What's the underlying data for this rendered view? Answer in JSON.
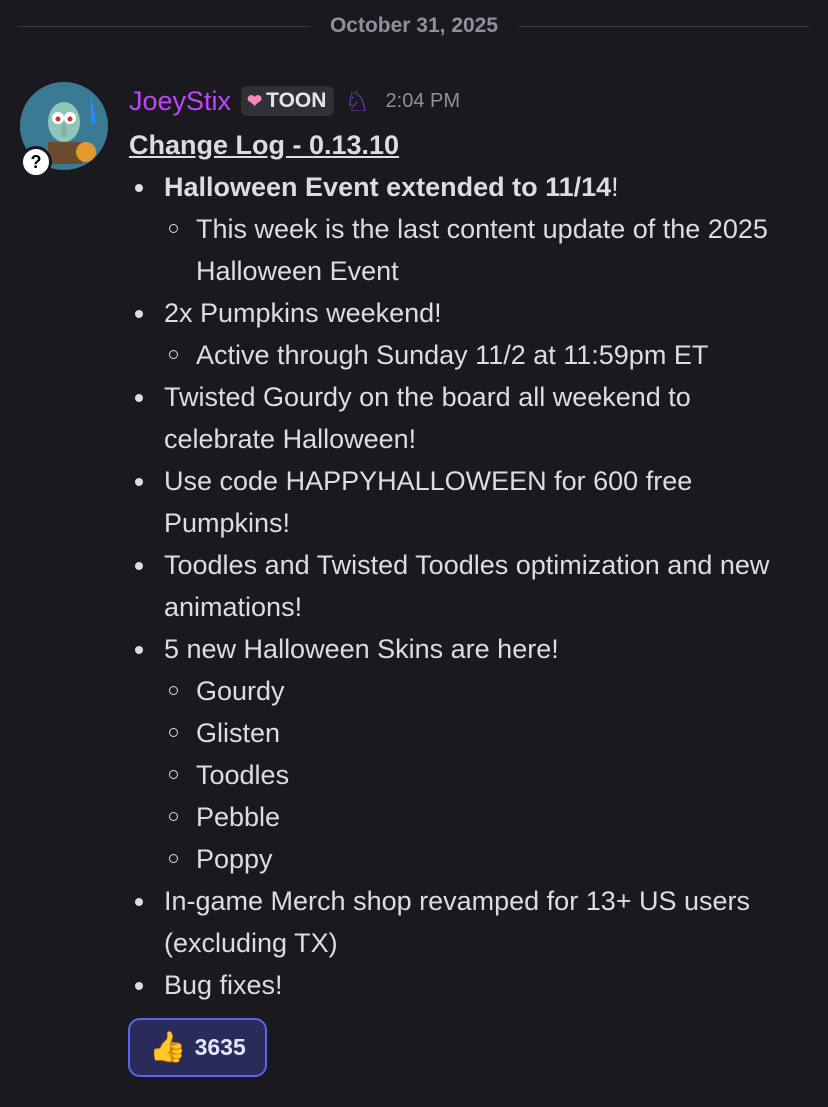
{
  "date_divider": "October 31, 2025",
  "message": {
    "author": "JoeyStix",
    "author_color": "#c145ff",
    "tag_icon": "heart-icon",
    "tag_label": "TOON",
    "role_icon": "purple-monster-icon",
    "timestamp": "2:04 PM",
    "title": "Change Log - 0.13.10",
    "items": [
      {
        "text_bold": "Halloween Event extended to 11/14",
        "text_after": "!",
        "sub": [
          "This week is the last content update of the 2025 Halloween Event"
        ]
      },
      {
        "text": "2x Pumpkins weekend!",
        "sub": [
          "Active through Sunday 11/2 at 11:59pm ET"
        ]
      },
      {
        "text": "Twisted Gourdy on the board all weekend to celebrate Halloween!"
      },
      {
        "text": "Use code HAPPYHALLOWEEN for 600 free Pumpkins!"
      },
      {
        "text": "Toodles and Twisted Toodles optimization and new animations!"
      },
      {
        "text": "5 new Halloween Skins are here!",
        "sub": [
          "Gourdy",
          "Glisten",
          "Toodles",
          "Pebble",
          "Poppy"
        ]
      },
      {
        "text": "In-game Merch shop revamped for 13+ US users (excluding TX)"
      },
      {
        "text": "Bug fixes!"
      }
    ]
  },
  "reaction": {
    "emoji": "thumbs-up-icon",
    "count": "3635"
  },
  "avatar_badge": "?"
}
